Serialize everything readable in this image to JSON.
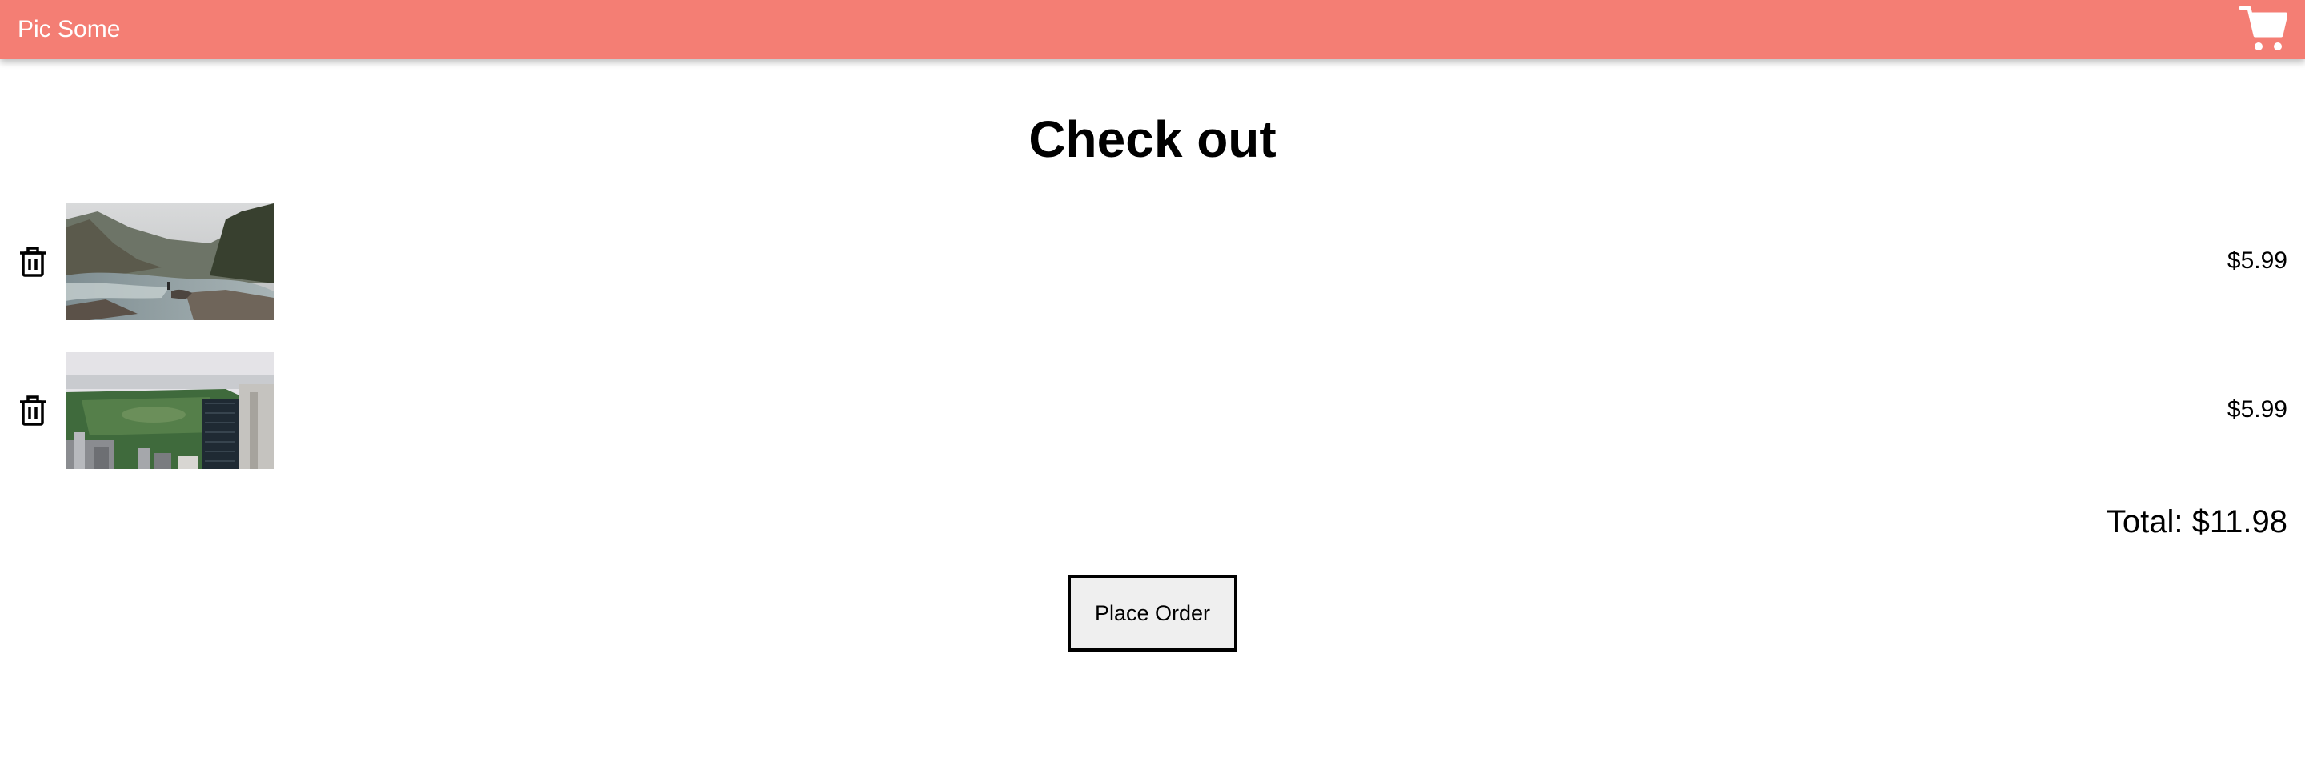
{
  "header": {
    "brand": "Pic Some",
    "cart_icon": "cart-icon",
    "color": "#f47e74"
  },
  "page": {
    "title": "Check out"
  },
  "cart": {
    "items": [
      {
        "image": "river-landscape-photo",
        "price": "$5.99",
        "remove_icon": "trash-icon"
      },
      {
        "image": "city-park-aerial-photo",
        "price": "$5.99",
        "remove_icon": "trash-icon"
      }
    ],
    "total": "Total: $11.98"
  },
  "actions": {
    "place_order_label": "Place Order"
  }
}
